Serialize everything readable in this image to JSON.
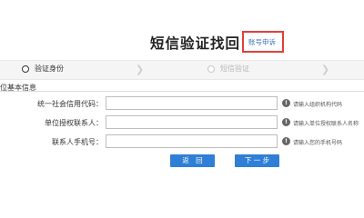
{
  "header": {
    "title": "短信验证找回",
    "appeal_link": "账号申诉"
  },
  "steps": [
    {
      "label": "验证身份"
    },
    {
      "label": "短信验证"
    }
  ],
  "section": {
    "title": "位基本信息"
  },
  "form": {
    "fields": [
      {
        "label": "统一社会信用代码：",
        "value": "",
        "hint": "请输入组织机构代码"
      },
      {
        "label": "单位授权联系人：",
        "value": "",
        "hint": "请输入单位授权联系人名称"
      },
      {
        "label": "联系人手机号：",
        "value": "",
        "hint": "请输入您的手机号码"
      }
    ],
    "back_label": "返   回",
    "next_label": "下 一 步"
  },
  "colors": {
    "accent": "#2f7fd6",
    "highlight_border": "#e0403a",
    "link": "#3a6fc4"
  }
}
